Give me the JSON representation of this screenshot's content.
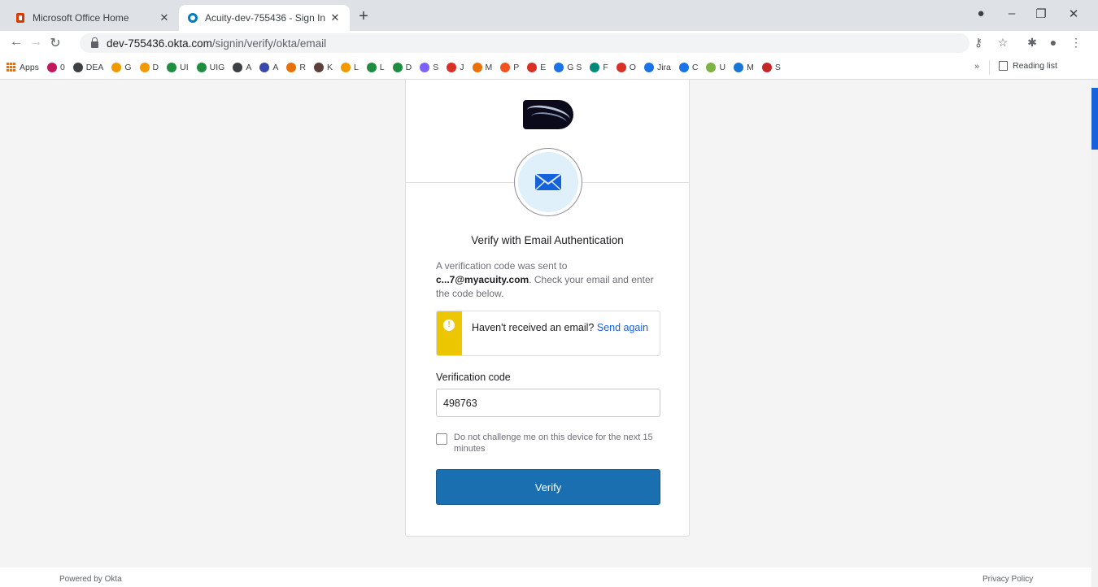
{
  "browser": {
    "tabs": [
      {
        "title": "Microsoft Office Home",
        "icon": "office-icon",
        "active": false
      },
      {
        "title": "Acuity-dev-755436 - Sign In",
        "icon": "okta-icon",
        "active": true
      }
    ],
    "new_tab_glyph": "+",
    "url_host": "dev-755436.okta.com",
    "url_path": "/signin/verify/okta/email",
    "bookmarks": [
      {
        "label": "Apps",
        "color": "#e8710a"
      },
      {
        "label": "0",
        "color": "#c2185b"
      },
      {
        "label": "DEA",
        "color": "#3c4043"
      },
      {
        "label": "G",
        "color": "#f29900"
      },
      {
        "label": "D",
        "color": "#f29900"
      },
      {
        "label": "UI",
        "color": "#1e8e3e"
      },
      {
        "label": "UIG",
        "color": "#1e8e3e"
      },
      {
        "label": "A",
        "color": "#3c4043"
      },
      {
        "label": "A",
        "color": "#3949ab"
      },
      {
        "label": "R",
        "color": "#e8710a"
      },
      {
        "label": "K",
        "color": "#5d4037"
      },
      {
        "label": "L",
        "color": "#f29900"
      },
      {
        "label": "L",
        "color": "#1e8e3e"
      },
      {
        "label": "D",
        "color": "#1e8e3e"
      },
      {
        "label": "S",
        "color": "#7b61ff"
      },
      {
        "label": "J",
        "color": "#d93025"
      },
      {
        "label": "M",
        "color": "#e8710a"
      },
      {
        "label": "P",
        "color": "#f4511e"
      },
      {
        "label": "E",
        "color": "#d93025"
      },
      {
        "label": "G S",
        "color": "#1a73e8"
      },
      {
        "label": "F",
        "color": "#00897b"
      },
      {
        "label": "O",
        "color": "#d93025"
      },
      {
        "label": "Jira",
        "color": "#1a73e8"
      },
      {
        "label": "C",
        "color": "#1a73e8"
      },
      {
        "label": "U",
        "color": "#7cb342"
      },
      {
        "label": "M",
        "color": "#1976d2"
      },
      {
        "label": "S",
        "color": "#c62828"
      }
    ],
    "more_glyph": "»",
    "reading_list": "Reading list"
  },
  "signin": {
    "heading": "Verify with Email Authentication",
    "desc_prefix": "A verification code was sent to ",
    "email": "c...7@myacuity.com",
    "desc_suffix": ". Check your email and enter the code below.",
    "callout_text": "Haven't received an email? ",
    "send_again": "Send again",
    "code_label": "Verification code",
    "code_value": "498763",
    "remember_label": "Do not challenge me on this device for the next 15 minutes",
    "verify_label": "Verify"
  },
  "footer": {
    "powered": "Powered by Okta",
    "privacy": "Privacy Policy"
  },
  "colors": {
    "verify_button": "#1a6fb0",
    "warning_bar": "#ecc600",
    "link": "#1662dd"
  }
}
